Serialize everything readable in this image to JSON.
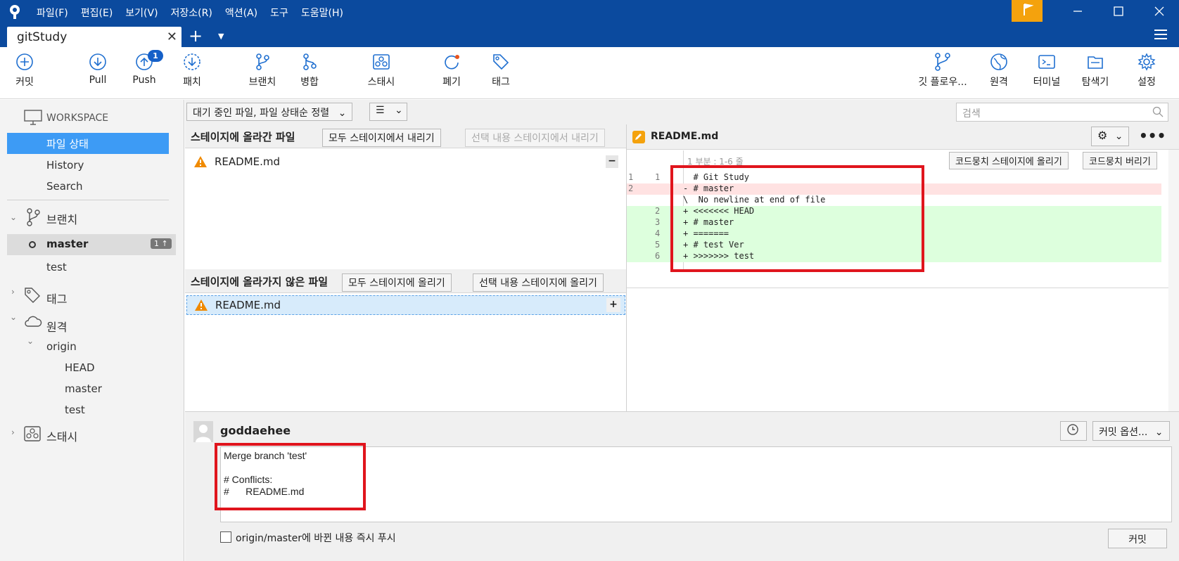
{
  "titlebar": {
    "menus": [
      "파일(F)",
      "편집(E)",
      "보기(V)",
      "저장소(R)",
      "액션(A)",
      "도구",
      "도움말(H)"
    ]
  },
  "tabbar": {
    "tab_label": "gitStudy"
  },
  "toolbar": {
    "commit": "커밋",
    "pull": "Pull",
    "push": "Push",
    "push_badge": "1",
    "patch": "패치",
    "branch": "브랜치",
    "merge": "병합",
    "stash": "스태시",
    "discard": "폐기",
    "tag": "태그",
    "git_flow": "깃 플로우...",
    "remote": "원격",
    "terminal": "터미널",
    "explorer": "탐색기",
    "settings": "설정"
  },
  "sidebar": {
    "workspace": "WORKSPACE",
    "file_status": "파일 상태",
    "history": "History",
    "search": "Search",
    "branches_label": "브랜치",
    "branch_master": "master",
    "branch_master_badge": "1 ↑",
    "branch_test": "test",
    "tags_label": "태그",
    "remotes_label": "원격",
    "origin": "origin",
    "remote_head": "HEAD",
    "remote_master": "master",
    "remote_test": "test",
    "stash_label": "스태시"
  },
  "filterbar": {
    "sort_dropdown": "대기 중인 파일, 파일 상태순 정렬",
    "view_icon": "list-icon",
    "search_placeholder": "검색"
  },
  "staged": {
    "title": "스테이지에 올라간 파일",
    "unstage_all": "모두 스테이지에서 내리기",
    "unstage_selected": "선택 내용 스테이지에서 내리기",
    "files": [
      "README.md"
    ]
  },
  "unstaged": {
    "title": "스테이지에 올라가지 않은 파일",
    "stage_all": "모두 스테이지에 올리기",
    "stage_selected": "선택 내용 스테이지에 올리기",
    "files": [
      "README.md"
    ]
  },
  "diff": {
    "filename": "README.md",
    "hunk_header": "1 부분 : 1-6 줄",
    "stage_hunk": "코드뭉치 스테이지에 올리기",
    "discard_hunk": "코드뭉치 버리기",
    "lines": [
      {
        "old": "1",
        "new": "1",
        "text": "  # Git Study",
        "type": "ctx"
      },
      {
        "old": "2",
        "new": "",
        "text": "- # master",
        "type": "del"
      },
      {
        "old": "",
        "new": "",
        "text": "\\  No newline at end of file",
        "type": "ctx"
      },
      {
        "old": "",
        "new": "2",
        "text": "+ <<<<<<< HEAD",
        "type": "add"
      },
      {
        "old": "",
        "new": "3",
        "text": "+ # master",
        "type": "add"
      },
      {
        "old": "",
        "new": "4",
        "text": "+ =======",
        "type": "add"
      },
      {
        "old": "",
        "new": "5",
        "text": "+ # test Ver",
        "type": "add"
      },
      {
        "old": "",
        "new": "6",
        "text": "+ >>>>>>> test",
        "type": "add"
      }
    ],
    "colors": {
      "add": "#ddffdd",
      "del": "#ffe2e2"
    }
  },
  "commit": {
    "author": "goddaehee",
    "options": "커밋 옵션...",
    "message_lines": [
      "Merge branch 'test'",
      "",
      "# Conflicts:",
      "#\tREADME.md"
    ],
    "push_checkbox_label": "origin/master에 바뀐 내용 즉시 푸시",
    "commit_button": "커밋"
  },
  "accent": {
    "highlight": "#e0151d",
    "selection": "#3d9bf5",
    "titlebar": "#0b4a9e"
  }
}
